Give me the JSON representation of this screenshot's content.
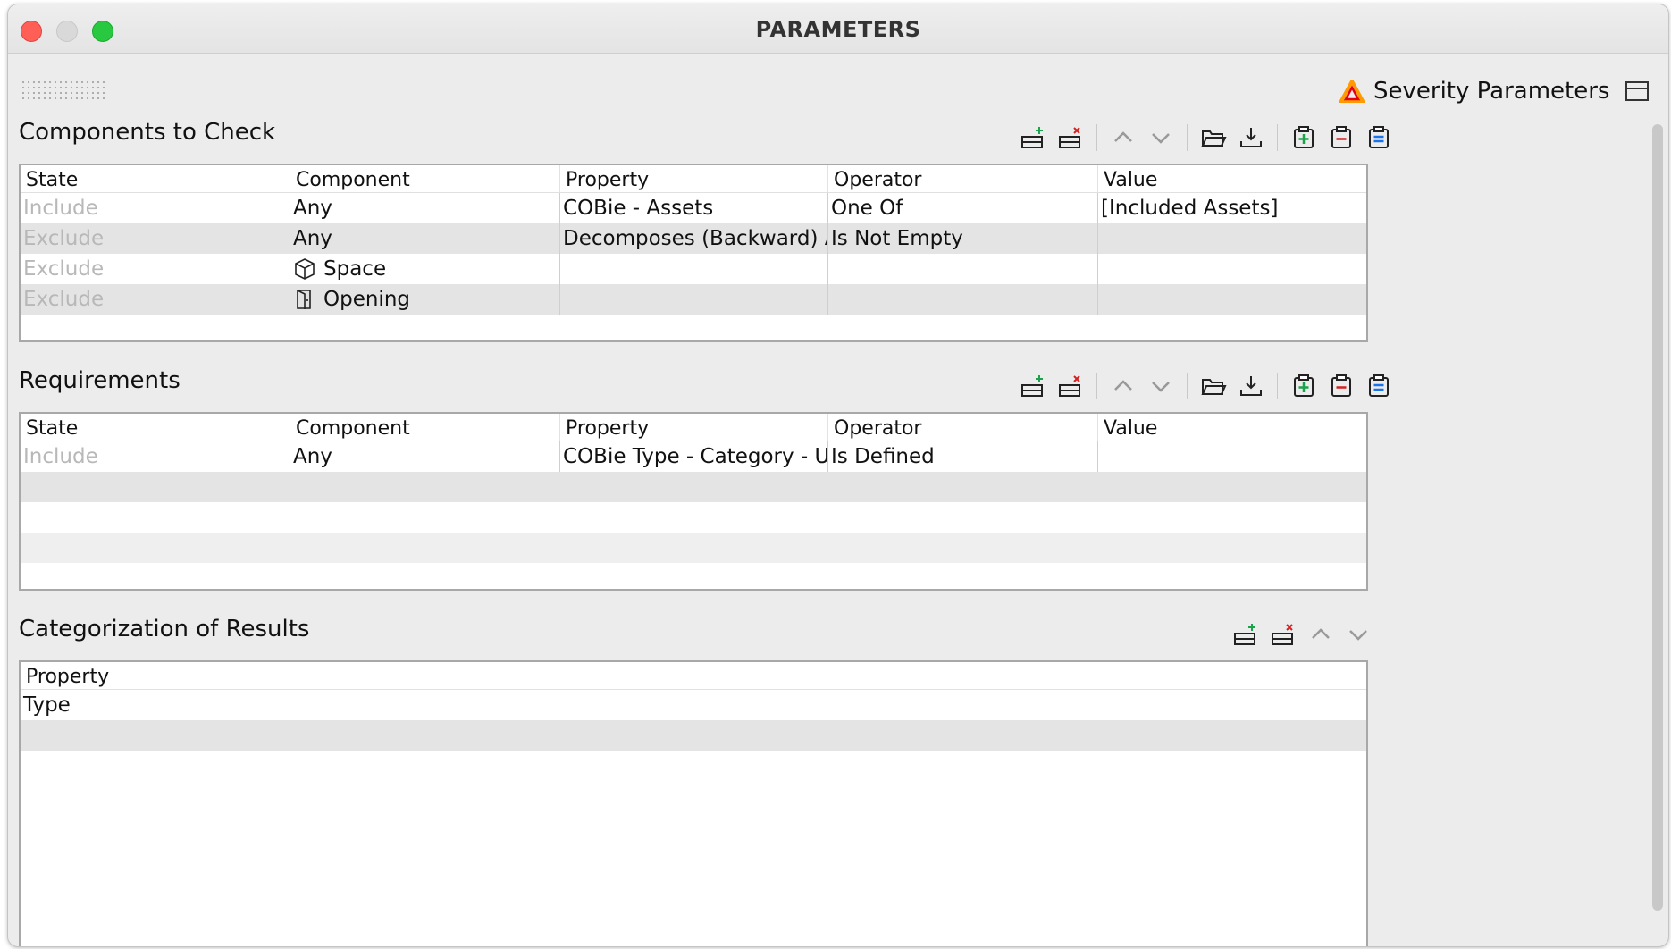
{
  "window": {
    "title": "PARAMETERS"
  },
  "header": {
    "severity_label": "Severity Parameters"
  },
  "components": {
    "title": "Components to Check",
    "columns": [
      "State",
      "Component",
      "Property",
      "Operator",
      "Value"
    ],
    "rows": [
      {
        "state": "Include",
        "component": "Any",
        "property": "COBie - Assets",
        "operator": "One Of",
        "value": "[Included Assets]"
      },
      {
        "state": "Exclude",
        "component": "Any",
        "property": "Decomposes (Backward) Any",
        "operator": "Is Not Empty",
        "value": ""
      },
      {
        "state": "Exclude",
        "component": "Space",
        "component_icon": "cube-icon",
        "property": "",
        "operator": "",
        "value": ""
      },
      {
        "state": "Exclude",
        "component": "Opening",
        "component_icon": "door-icon",
        "property": "",
        "operator": "",
        "value": ""
      }
    ]
  },
  "requirements": {
    "title": "Requirements",
    "columns": [
      "State",
      "Component",
      "Property",
      "Operator",
      "Value"
    ],
    "rows": [
      {
        "state": "Include",
        "component": "Any",
        "property": "COBie Type - Category - Un...",
        "operator": "Is Defined",
        "value": ""
      }
    ]
  },
  "categorization": {
    "title": "Categorization of Results",
    "columns": [
      "Property"
    ],
    "rows": [
      {
        "property": "Type"
      }
    ]
  },
  "icons": {
    "severity": "warning-triangle-icon",
    "toolbar": [
      "add-row-icon",
      "remove-row-icon",
      "move-up-icon",
      "move-down-icon",
      "open-folder-icon",
      "download-icon",
      "add-clipboard-icon",
      "remove-clipboard-icon",
      "equal-clipboard-icon"
    ],
    "colors": {
      "add": "#1aa34a",
      "remove": "#d42020",
      "equal": "#1a73e8",
      "warning_outer": "#ff9a00",
      "warning_inner": "#e60012"
    }
  }
}
